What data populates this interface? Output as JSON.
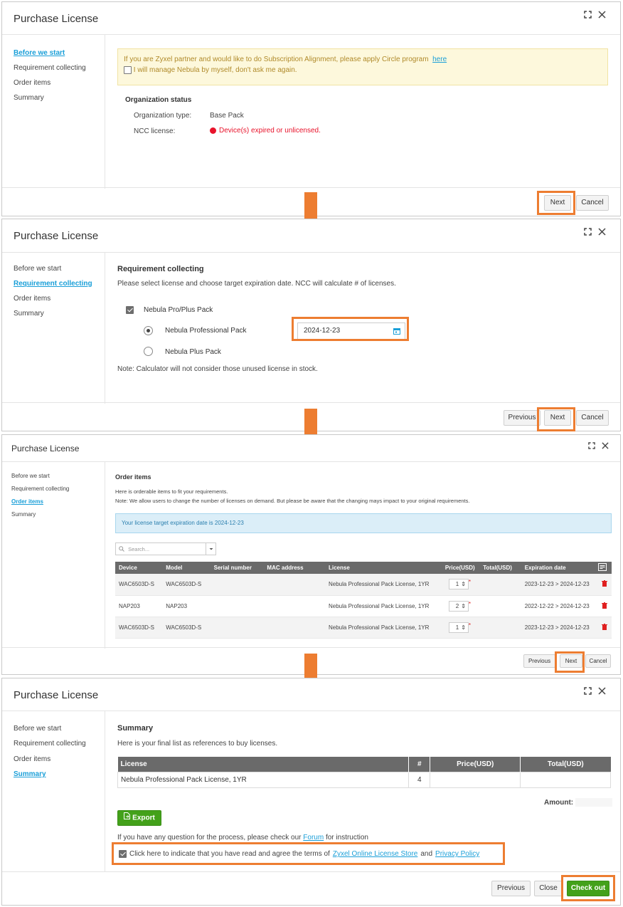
{
  "dialog_title": "Purchase License",
  "steps": [
    "Before we start",
    "Requirement collecting",
    "Order items",
    "Summary"
  ],
  "buttons": {
    "next": "Next",
    "cancel": "Cancel",
    "previous": "Previous",
    "close": "Close",
    "checkout": "Check out",
    "export": "Export"
  },
  "step1": {
    "notice_text": "If you are Zyxel partner and would like to do Subscription Alignment, please apply Circle program",
    "notice_link": "here",
    "manage_label": "I will manage Nebula by myself, don't ask me again.",
    "org_status_title": "Organization status",
    "org_type_label": "Organization type:",
    "org_type_value": "Base Pack",
    "ncc_label": "NCC license:",
    "ncc_value": "Device(s) expired or unlicensed.",
    "ncc_status_color": "#e8132b"
  },
  "step2": {
    "heading": "Requirement collecting",
    "description": "Please select license and choose target expiration date. NCC will calculate # of licenses.",
    "pack_group": "Nebula Pro/Plus Pack",
    "option_pro": "Nebula Professional Pack",
    "option_plus": "Nebula Plus Pack",
    "date_value": "2024-12-23",
    "note": "Note: Calculator will not consider those unused license in stock."
  },
  "step3": {
    "heading": "Order items",
    "line1": "Here is orderable items to fit your requirements.",
    "line2": "Note: We allow users to change the number of licenses on demand. But please be aware that the changing mays impact to your original requirements.",
    "info_banner": "Your license target expiration date is 2024-12-23",
    "search_placeholder": "Search...",
    "columns": [
      "Device",
      "Model",
      "Serial number",
      "MAC address",
      "License",
      "Price(USD)",
      "Total(USD)",
      "Expiration date"
    ],
    "rows": [
      {
        "device": "WAC6503D-S",
        "model": "WAC6503D-S",
        "license": "Nebula Professional Pack License, 1YR",
        "qty": "1",
        "expiration": "2023-12-23 > 2024-12-23"
      },
      {
        "device": "NAP203",
        "model": "NAP203",
        "license": "Nebula Professional Pack License, 1YR",
        "qty": "2",
        "expiration": "2022-12-22 > 2024-12-23"
      },
      {
        "device": "WAC6503D-S",
        "model": "WAC6503D-S",
        "license": "Nebula Professional Pack License, 1YR",
        "qty": "1",
        "expiration": "2023-12-23 > 2024-12-23"
      }
    ]
  },
  "step4": {
    "heading": "Summary",
    "description": "Here is your final list as references to buy licenses.",
    "columns": [
      "License",
      "#",
      "Price(USD)",
      "Total(USD)"
    ],
    "row": {
      "license": "Nebula Professional Pack License, 1YR",
      "count": "4",
      "price": "",
      "total": ""
    },
    "amount_label": "Amount:",
    "question_prefix": "If you have any question for the process, please check our",
    "forum_link": "Forum",
    "question_suffix": "for instruction",
    "agree_prefix": "Click here to indicate that you have read and agree the terms of",
    "store_link": "Zyxel Online License Store",
    "agree_and": "and",
    "privacy_link": "Privacy Policy"
  },
  "colors": {
    "accent": "#1a9fd8",
    "highlight": "#ed7d31",
    "checkout": "#43a11a",
    "table_header": "#6a6a6a"
  }
}
